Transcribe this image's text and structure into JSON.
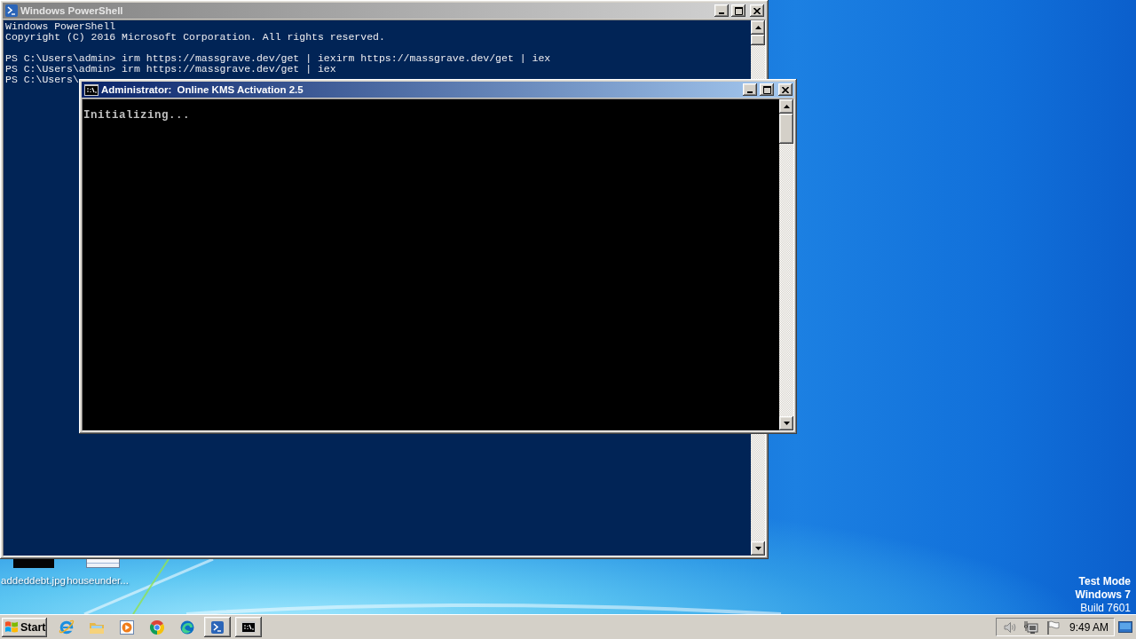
{
  "windows": [
    {
      "kind": "powershell",
      "title": "Windows PowerShell",
      "active": false,
      "blocks": [
        [
          "Windows PowerShell",
          "Copyright (C) 2016 Microsoft Corporation. All rights reserved."
        ],
        [
          "PS C:\\Users\\admin> irm https://massgrave.dev/get | iexirm https://massgrave.dev/get | iex",
          "PS C:\\Users\\admin> irm https://massgrave.dev/get | iex",
          "PS C:\\Users\\"
        ]
      ]
    },
    {
      "kind": "cmd",
      "title": "Administrator:  Online KMS Activation 2.5",
      "active": true,
      "blocks": [
        [
          "Initializing..."
        ]
      ]
    }
  ],
  "desktop": {
    "icons": [
      {
        "kind": "image",
        "label": "addeddebt.jpg"
      },
      {
        "kind": "document",
        "label": "houseunder..."
      }
    ],
    "system_info": {
      "mode": "Test Mode",
      "edition": "Windows 7",
      "build": "Build 7601"
    }
  },
  "taskbar": {
    "start": "Start",
    "buttons": [
      {
        "kind": "powershell"
      },
      {
        "kind": "cmd"
      }
    ],
    "clock": "9:49 AM"
  }
}
